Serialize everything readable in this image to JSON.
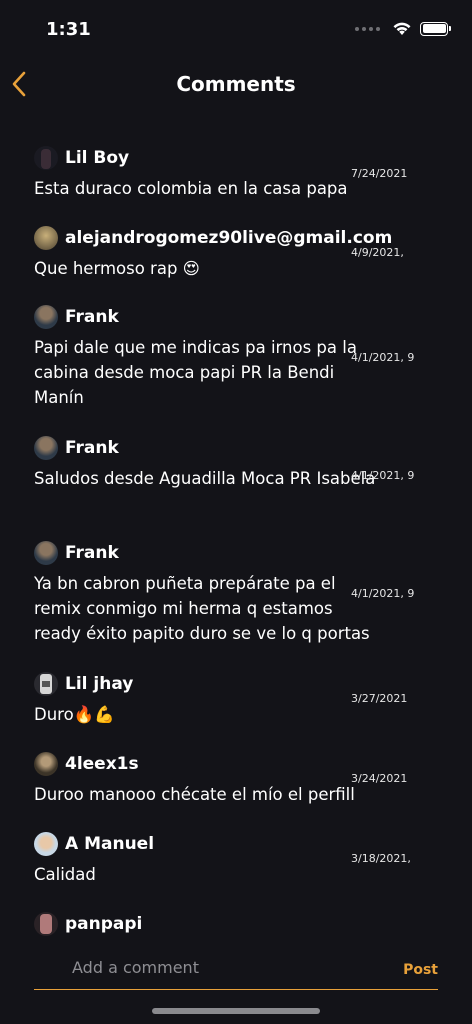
{
  "status_bar": {
    "time": "1:31"
  },
  "header": {
    "title": "Comments"
  },
  "colors": {
    "accent": "#e8a13a",
    "background": "#131318"
  },
  "comments": [
    {
      "username": "Lil Boy",
      "text": "Esta duraco colombia en la casa papa",
      "date": "7/24/2021",
      "avatar_color": "#2a2230"
    },
    {
      "username": "alejandrogomez90live@gmail.com",
      "text": "Que hermoso rap 😍",
      "date": "4/9/2021,",
      "avatar_color": "#7b6a3e"
    },
    {
      "username": "Frank",
      "text": "Papi dale que me indicas pa irnos pa la cabina desde moca papi PR la Bendi Manín",
      "date": "4/1/2021, 9",
      "avatar_color": "#3c4a5a"
    },
    {
      "username": "Frank",
      "text": "Saludos desde Aguadilla Moca PR Isabela",
      "date": "4/1/2021, 9",
      "avatar_color": "#3c4a5a"
    },
    {
      "username": "Frank",
      "text": "Ya bn cabron puñeta prepárate pa el remix conmigo mi herma q estamos ready éxito papito duro se ve lo q portas",
      "date": "4/1/2021, 9",
      "avatar_color": "#3c4a5a"
    },
    {
      "username": "Lil jhay",
      "text": "Duro🔥💪",
      "date": "3/27/2021",
      "avatar_color": "#cfcfcf"
    },
    {
      "username": "4leex1s",
      "text": "Duroo manooo chécate el mío el perfill",
      "date": "3/24/2021",
      "avatar_color": "#5a5040"
    },
    {
      "username": "A Manuel",
      "text": "Calidad",
      "date": "3/18/2021,",
      "avatar_color": "#d8e4ee"
    },
    {
      "username": "panpapi",
      "text": "",
      "date": "",
      "avatar_color": "#8a6a6a"
    }
  ],
  "composer": {
    "placeholder": "Add a comment",
    "post_label": "Post"
  }
}
